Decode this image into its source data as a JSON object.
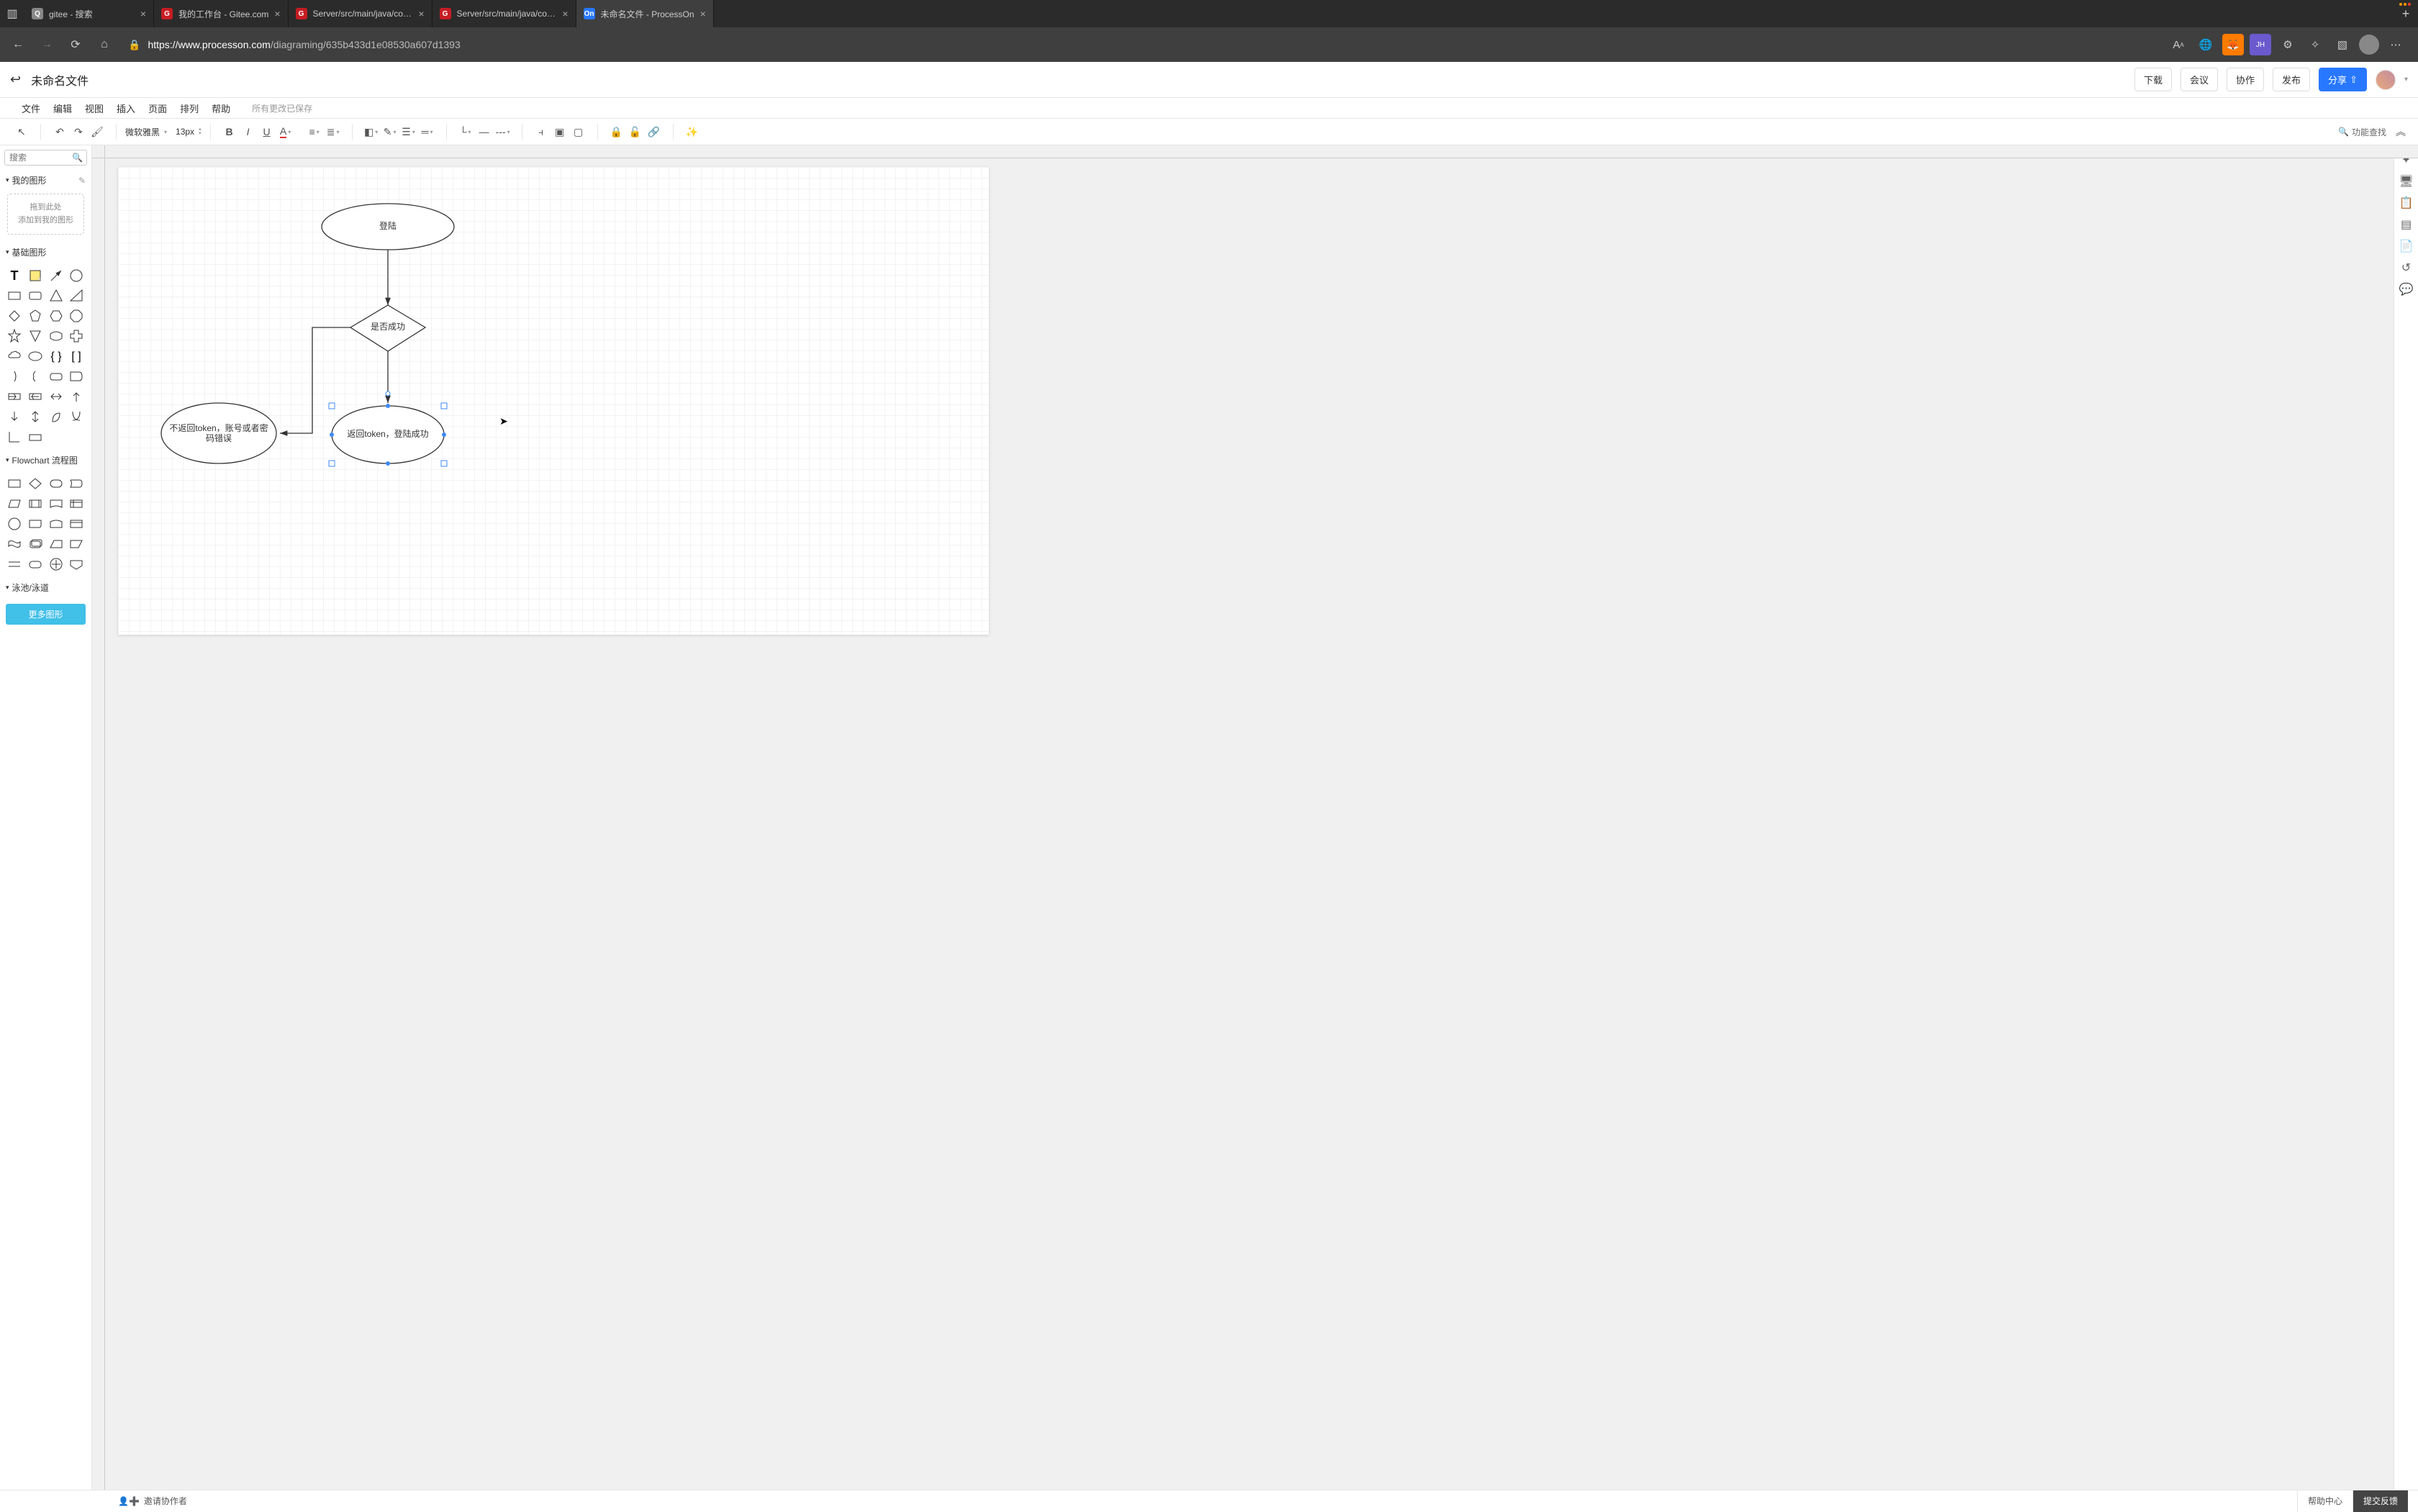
{
  "browser": {
    "tabs": [
      {
        "icon": "Q",
        "iconColor": "#888",
        "label": "gitee - 搜索"
      },
      {
        "icon": "G",
        "iconColor": "#c71d23",
        "label": "我的工作台 - Gitee.com"
      },
      {
        "icon": "G",
        "iconColor": "#c71d23",
        "label": "Server/src/main/java/com/null…"
      },
      {
        "icon": "G",
        "iconColor": "#c71d23",
        "label": "Server/src/main/java/com/null…"
      },
      {
        "icon": "On",
        "iconColor": "#2878ff",
        "label": "未命名文件 - ProcessOn",
        "active": true
      }
    ],
    "url_host": "https://www.processon.com",
    "url_path": "/diagraming/635b433d1e08530a607d1393"
  },
  "header": {
    "doc_title": "未命名文件",
    "buttons": {
      "download": "下载",
      "meeting": "会议",
      "collab": "协作",
      "publish": "发布",
      "share": "分享"
    }
  },
  "menu": {
    "items": [
      "文件",
      "编辑",
      "视图",
      "插入",
      "页面",
      "排列",
      "帮助"
    ],
    "save_status": "所有更改已保存"
  },
  "toolbar": {
    "font_family": "微软雅黑",
    "font_size": "13px",
    "search_label": "功能查找"
  },
  "left_panel": {
    "search_placeholder": "搜索",
    "my_shapes": "我的图形",
    "drop_line1": "拖到此处",
    "drop_line2": "添加到我的图形",
    "basic_shapes": "基础图形",
    "flowchart": "Flowchart 流程图",
    "lane": "泳池/泳道",
    "more_shapes": "更多图形"
  },
  "canvas": {
    "nodes": {
      "login": "登陆",
      "decision": "是否成功",
      "fail_line1": "不返回token，账号或者密",
      "fail_line2": "码错误",
      "success": "返回token，登陆成功"
    }
  },
  "bottom": {
    "invite": "邀请协作者",
    "help": "帮助中心",
    "feedback": "提交反馈"
  }
}
